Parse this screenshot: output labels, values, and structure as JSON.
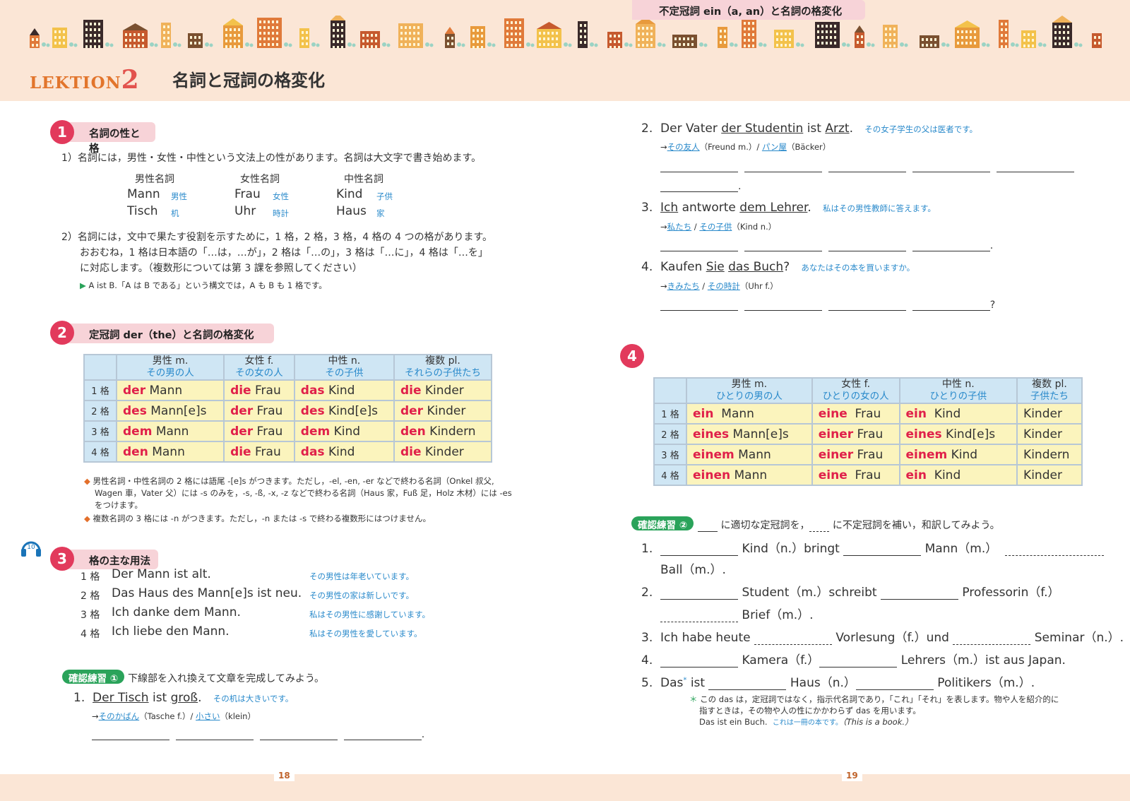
{
  "header": {
    "lektion_label": "LEKTION",
    "lektion_number": "2",
    "title": "名詞と冠詞の格変化"
  },
  "colors": {
    "accent": "#e23a5c",
    "header_bg": "#fbe6d6",
    "blue_text": "#2a8acb",
    "red_text": "#e0204a",
    "table_header": "#cfe6f4",
    "table_cell": "#fbf4bd",
    "green": "#2aa35a"
  },
  "icons": {
    "town": "town-skyline-icon",
    "audio": "headphones-icon",
    "bullet": "triangle-bullet-icon",
    "diamond": "diamond-bullet-icon"
  },
  "s1": {
    "num": "1",
    "title": "名詞の性と格",
    "p1": "1）名詞には，男性・女性・中性という文法上の性があります。名詞は大文字で書き始めます。",
    "head_m": "男性名詞",
    "head_f": "女性名詞",
    "head_n": "中性名詞",
    "m1": "Mann",
    "m1j": "男性",
    "f1": "Frau",
    "f1j": "女性",
    "n1": "Kind",
    "n1j": "子供",
    "m2": "Tisch",
    "m2j": "机",
    "f2": "Uhr",
    "f2j": "時計",
    "n2": "Haus",
    "n2j": "家",
    "p2a": "2）名詞には，文中で果たす役割を示すために，1 格，2 格，3 格，4 格の 4 つの格があります。",
    "p2b": "おおむね，1 格は日本語の「…は，…が」，2 格は「…の」，3 格は「…に」，4 格は「…を」",
    "p2c": "に対応します。（複数形については第 3 課を参照してください）",
    "note": "A ist B.「A は B である」という構文では，A も B も 1 格です。"
  },
  "s2": {
    "num": "2",
    "title": "定冠詞 der（the）と名詞の格変化",
    "cols": [
      {
        "h": "男性 m.",
        "j": "その男の人"
      },
      {
        "h": "女性 f.",
        "j": "その女の人"
      },
      {
        "h": "中性 n.",
        "j": "その子供"
      },
      {
        "h": "複数 pl.",
        "j": "それらの子供たち"
      }
    ],
    "rows": [
      {
        "case": "1 格",
        "c": [
          [
            "der",
            " Mann"
          ],
          [
            "die",
            " Frau"
          ],
          [
            "das",
            " Kind"
          ],
          [
            "die",
            " Kinder"
          ]
        ]
      },
      {
        "case": "2 格",
        "c": [
          [
            "des",
            " Mann[e]s"
          ],
          [
            "der",
            " Frau"
          ],
          [
            "des",
            " Kind[e]s"
          ],
          [
            "der",
            " Kinder"
          ]
        ]
      },
      {
        "case": "3 格",
        "c": [
          [
            "dem",
            " Mann"
          ],
          [
            "der",
            " Frau"
          ],
          [
            "dem",
            " Kind"
          ],
          [
            "den",
            " Kindern"
          ]
        ]
      },
      {
        "case": "4 格",
        "c": [
          [
            "den",
            " Mann"
          ],
          [
            "die",
            " Frau"
          ],
          [
            "das",
            " Kind"
          ],
          [
            "die",
            " Kinder"
          ]
        ]
      }
    ],
    "note1a": "男性名詞・中性名詞の 2 格には語尾 -[e]s がつきます。ただし，-el, -en, -er などで終わる名詞（Onkel 叔父,",
    "note1b": "Wagen 車，Vater 父）には -s のみを，-s, -ß, -x, -z などで終わる名詞（Haus 家，Fuß 足，Holz 木材）には -es",
    "note1c": "をつけます。",
    "note2": "複数名詞の 3 格には -n がつきます。ただし，-n または -s で終わる複数形にはつけません。"
  },
  "s3": {
    "num": "3",
    "title": "格の主な用法",
    "audio_track": "10",
    "rows": [
      {
        "case": "1 格",
        "de": "Der Mann ist alt.",
        "ja": "その男性は年老いています。"
      },
      {
        "case": "2 格",
        "de": "Das Haus des Mann[e]s ist neu.",
        "ja": "その男性の家は新しいです。"
      },
      {
        "case": "3 格",
        "de": "Ich danke dem Mann.",
        "ja": "私はその男性に感謝しています。"
      },
      {
        "case": "4 格",
        "de": "Ich liebe den Mann.",
        "ja": "私はその男性を愛しています。"
      }
    ]
  },
  "drill1": {
    "label": "確認練習 ①",
    "instruction": "下線部を入れ換えて文章を完成してみよう。",
    "items": [
      {
        "n": "1.",
        "a": "Der Tisch",
        "b": " ist ",
        "c": "groß",
        "d": ".",
        "ja": "その机は大きいです。",
        "hint_a": "そのかばん",
        "hint_b": "（Tasche f.）/ ",
        "hint_c": "小さい",
        "hint_d": "（klein）",
        "end": "."
      },
      {
        "n": "2.",
        "a": "Der Vater ",
        "b": "der Studentin",
        "c": " ist ",
        "d": "Arzt",
        "e": ".",
        "ja": "その女子学生の父は医者です。",
        "hint_a": "その友人",
        "hint_b": "（Freund m.）/ ",
        "hint_c": "パン屋",
        "hint_d": "（Bäcker）",
        "end": "."
      },
      {
        "n": "3.",
        "a": "Ich",
        "b": " antworte ",
        "c": "dem Lehrer",
        "d": ".",
        "ja": "私はその男性教師に答えます。",
        "hint_a": "私たち",
        "hint_b": " / ",
        "hint_c": "その子供",
        "hint_d": "（Kind n.）",
        "end": "."
      },
      {
        "n": "4.",
        "a": "Kaufen ",
        "b": "Sie",
        "c": " ",
        "d": "das Buch",
        "e": "?",
        "ja": "あなたはその本を買いますか。",
        "hint_a": "きみたち",
        "hint_b": " / ",
        "hint_c": "その時計",
        "hint_d": "（Uhr f.）",
        "end": "?"
      }
    ]
  },
  "s4": {
    "num": "4",
    "title": "不定冠詞 ein（a, an）と名詞の格変化",
    "cols": [
      {
        "h": "男性 m.",
        "j": "ひとりの男の人"
      },
      {
        "h": "女性 f.",
        "j": "ひとりの女の人"
      },
      {
        "h": "中性 n.",
        "j": "ひとりの子供"
      },
      {
        "h": "複数 pl.",
        "j": "子供たち"
      }
    ],
    "rows": [
      {
        "case": "1 格",
        "c": [
          [
            "ein",
            "  Mann"
          ],
          [
            "eine",
            "  Frau"
          ],
          [
            "ein",
            "  Kind"
          ],
          [
            "",
            "Kinder"
          ]
        ]
      },
      {
        "case": "2 格",
        "c": [
          [
            "eines",
            " Mann[e]s"
          ],
          [
            "einer",
            " Frau"
          ],
          [
            "eines",
            " Kind[e]s"
          ],
          [
            "",
            "Kinder"
          ]
        ]
      },
      {
        "case": "3 格",
        "c": [
          [
            "einem",
            " Mann"
          ],
          [
            "einer",
            " Frau"
          ],
          [
            "einem",
            " Kind"
          ],
          [
            "",
            "Kindern"
          ]
        ]
      },
      {
        "case": "4 格",
        "c": [
          [
            "einen",
            " Mann"
          ],
          [
            "eine",
            "  Frau"
          ],
          [
            "ein",
            "  Kind"
          ],
          [
            "",
            "Kinder"
          ]
        ]
      }
    ]
  },
  "drill2": {
    "label": "確認練習 ②",
    "instruction_a": " に適切な定冠詞を，",
    "instruction_b": " に不定冠詞を補い，和訳してみよう。",
    "i1a": "1.",
    "i1b": " Kind（n.）bringt ",
    "i1c": " Mann（m.）",
    "i1d": "Ball（m.）.",
    "i2a": "2.",
    "i2b": " Student（m.）schreibt ",
    "i2c": " Professorin（f.）",
    "i2d": " Brief（m.）.",
    "i3a": "3.",
    "i3b": "Ich habe heute ",
    "i3c": " Vorlesung（f.）und ",
    "i3d": " Seminar（n.）.",
    "i4a": "4.",
    "i4b": " Kamera（f.）",
    "i4c": " Lehrers（m.）ist aus Japan.",
    "i5a": "5.",
    "i5b": "Das",
    "i5star": "*",
    "i5c": " ist ",
    "i5d": " Haus（n.）",
    "i5e": " Politikers（m.）.",
    "fn1": "この das は，定冠詞ではなく，指示代名詞であり，「これ」「それ」を表します。物や人を紹介的に",
    "fn2": "指すときは，その物や人の性にかかわらず das を用います。",
    "fn3a": "Das ist ein Buch.",
    "fn3b": "これは一冊の本です。",
    "fn3c": "（This is a book.）"
  },
  "pages": {
    "left": "18",
    "right": "19"
  }
}
